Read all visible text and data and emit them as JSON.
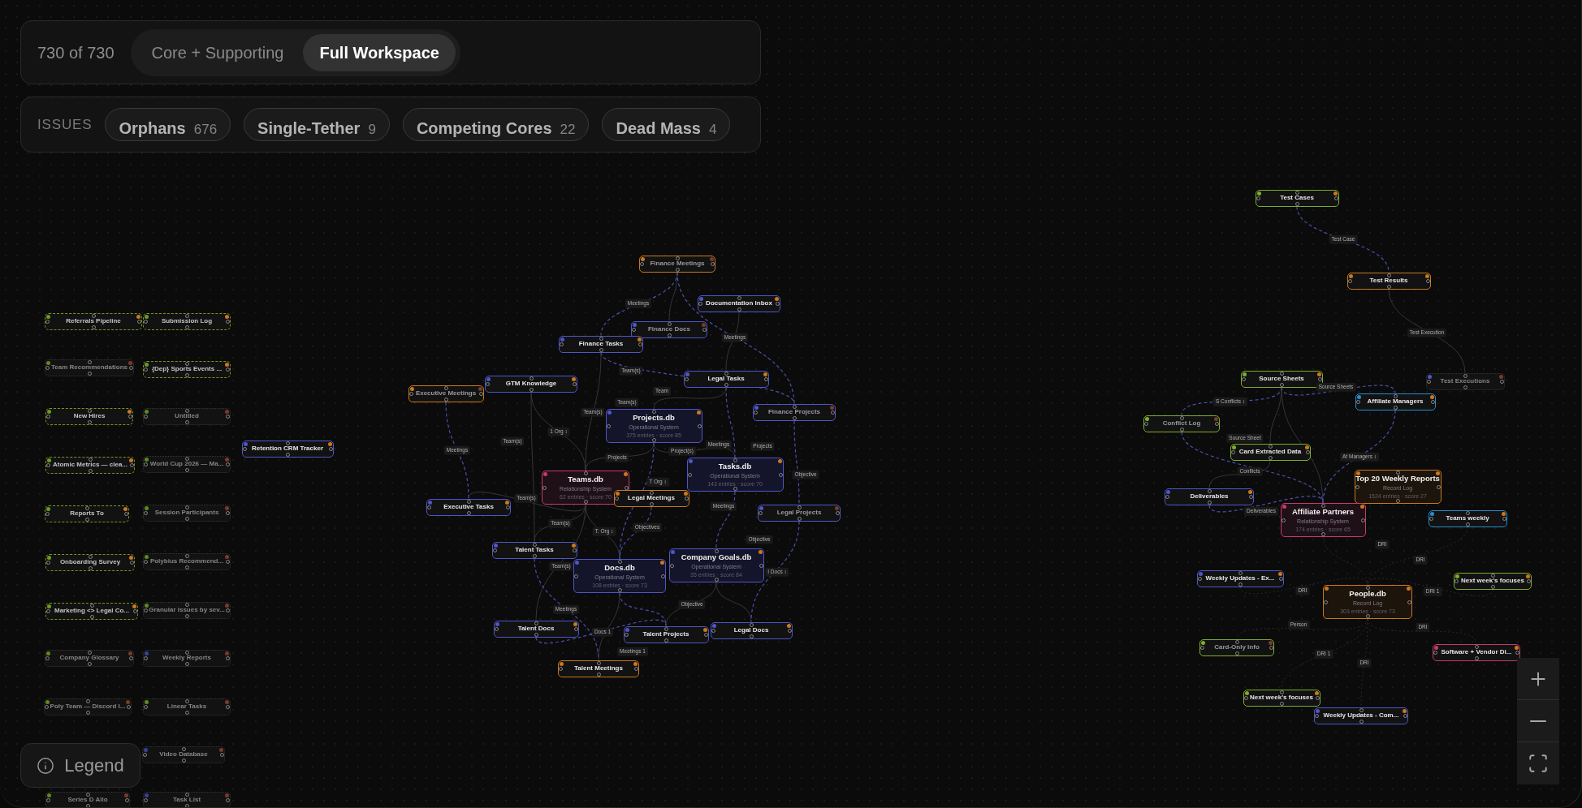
{
  "toolbar": {
    "count": "730 of 730",
    "views": [
      {
        "label": "Core + Supporting",
        "selected": false
      },
      {
        "label": "Full Workspace",
        "selected": true
      }
    ]
  },
  "issues": {
    "label": "ISSUES",
    "items": [
      {
        "name": "Orphans",
        "count": "676"
      },
      {
        "name": "Single-Tether",
        "count": "9"
      },
      {
        "name": "Competing Cores",
        "count": "22"
      },
      {
        "name": "Dead Mass",
        "count": "4"
      }
    ]
  },
  "nodes": [
    {
      "label": "Referrals Pipeline",
      "kind": "dashed",
      "color": "#6f9a22"
    },
    {
      "label": "Submission Log",
      "kind": "dashed",
      "color": "#6f9a22"
    },
    {
      "label": "Team Recommendations",
      "kind": "faint",
      "color": "#5f8a1e"
    },
    {
      "label": "{Dep} Sports Events ...",
      "kind": "dashed",
      "color": "#6f9a22"
    },
    {
      "label": "New Hires",
      "kind": "dashed",
      "color": "#6f9a22"
    },
    {
      "label": "Untitled",
      "kind": "faint",
      "color": "#5f8a1e"
    },
    {
      "label": "Atomic Metrics — clea...",
      "kind": "dashed",
      "color": "#6f9a22"
    },
    {
      "label": "World Cup 2026 — Ma...",
      "kind": "faint",
      "color": "#5f8a1e"
    },
    {
      "label": "Reports To",
      "kind": "dashed",
      "color": "#6f9a22"
    },
    {
      "label": "Session Participants",
      "kind": "faint",
      "color": "#5f8a1e"
    },
    {
      "label": "Onboarding Survey",
      "kind": "dashed",
      "color": "#6f9a22"
    },
    {
      "label": "Polybius Recommend...",
      "kind": "faint",
      "color": "#5f8a1e"
    },
    {
      "label": "Marketing <> Legal Co...",
      "kind": "dashed",
      "color": "#6f9a22"
    },
    {
      "label": "Granular issues by sev...",
      "kind": "faint",
      "color": "#5f8a1e"
    },
    {
      "label": "Company Glossary",
      "kind": "faint",
      "color": "#5f8a1e"
    },
    {
      "label": "Weekly Reports",
      "kind": "faint",
      "color": "#3b4096"
    },
    {
      "label": "Poly Team — Discord I...",
      "kind": "faint",
      "color": "#5f8a1e"
    },
    {
      "label": "Linear Tasks",
      "kind": "faint",
      "color": "#5f8a1e"
    },
    {
      "label": "Video Database",
      "kind": "faint",
      "color": "#3b4096"
    },
    {
      "label": "Series D Allo",
      "kind": "faint",
      "color": "#5f8a1e"
    },
    {
      "label": "Task List",
      "kind": "faint",
      "color": "#3b4096"
    },
    {
      "label": "Retention CRM Tracker",
      "kind": "solid",
      "color": "#4f56c8"
    },
    {
      "label": "Finance Meetings",
      "kind": "muted",
      "color": "#c9781f"
    },
    {
      "label": "Documentation Inbox",
      "kind": "solid",
      "color": "#4f56c8"
    },
    {
      "label": "Finance Docs",
      "kind": "muted",
      "color": "#4f56c8"
    },
    {
      "label": "Finance Tasks",
      "kind": "solid",
      "color": "#4f56c8"
    },
    {
      "label": "GTM Knowledge",
      "kind": "solid",
      "color": "#4f56c8"
    },
    {
      "label": "Executive Meetings",
      "kind": "muted",
      "color": "#c9781f"
    },
    {
      "label": "Legal Tasks",
      "kind": "solid",
      "color": "#4f56c8"
    },
    {
      "label": "Finance Projects",
      "kind": "muted",
      "color": "#4f56c8"
    },
    {
      "label": "Projects.db",
      "kind": "db",
      "color": "#4f56c8",
      "subtitle": "Operational System",
      "meta": "375 entries · score 85"
    },
    {
      "label": "Tasks.db",
      "kind": "db",
      "color": "#4f56c8",
      "subtitle": "Operational System",
      "meta": "143 entries · score 70"
    },
    {
      "label": "Teams.db",
      "kind": "db",
      "color": "#c73a6b",
      "subtitle": "Relationship System",
      "meta": "62 entries · score 70"
    },
    {
      "label": "Legal Meetings",
      "kind": "solid",
      "color": "#c9781f"
    },
    {
      "label": "Executive Tasks",
      "kind": "solid",
      "color": "#4f56c8"
    },
    {
      "label": "Legal Projects",
      "kind": "muted",
      "color": "#4f56c8"
    },
    {
      "label": "Talent Tasks",
      "kind": "solid",
      "color": "#4f56c8"
    },
    {
      "label": "Docs.db",
      "kind": "db",
      "color": "#4f56c8",
      "subtitle": "Operational System",
      "meta": "108 entries · score 73"
    },
    {
      "label": "Company Goals.db",
      "kind": "db",
      "color": "#4f56c8",
      "subtitle": "Operational System",
      "meta": "35 entries · score 84"
    },
    {
      "label": "Talent Docs",
      "kind": "solid",
      "color": "#4f56c8"
    },
    {
      "label": "Talent Projects",
      "kind": "solid",
      "color": "#4f56c8"
    },
    {
      "label": "Legal Docs",
      "kind": "solid",
      "color": "#4f56c8"
    },
    {
      "label": "Talent Meetings",
      "kind": "solid",
      "color": "#c9781f"
    },
    {
      "label": "Test Cases",
      "kind": "solid",
      "color": "#7cae2a"
    },
    {
      "label": "Test Results",
      "kind": "solid",
      "color": "#c9781f"
    },
    {
      "label": "Test Executions",
      "kind": "faint",
      "color": "#4f56c8"
    },
    {
      "label": "Source Sheets",
      "kind": "solid",
      "color": "#7cae2a"
    },
    {
      "label": "Affiliate Managers",
      "kind": "solid",
      "color": "#2a8ccc"
    },
    {
      "label": "Conflict Log",
      "kind": "muted",
      "color": "#7cae2a"
    },
    {
      "label": "Card Extracted Data",
      "kind": "solid",
      "color": "#7cae2a"
    },
    {
      "label": "Deliverables",
      "kind": "solid",
      "color": "#4f56c8"
    },
    {
      "label": "Top 20 Weekly Reports",
      "kind": "db",
      "color": "#c9781f",
      "subtitle": "Record Log",
      "meta": "1524 entries · score 27"
    },
    {
      "label": "Affiliate Partners",
      "kind": "db",
      "color": "#c73a6b",
      "subtitle": "Relationship System",
      "meta": "174 entries · score 65"
    },
    {
      "label": "Teams weekly",
      "kind": "solid",
      "color": "#2a8ccc"
    },
    {
      "label": "Weekly Updates - Ex...",
      "kind": "solid",
      "color": "#4f56c8"
    },
    {
      "label": "Next week's focuses",
      "kind": "solid",
      "color": "#7cae2a"
    },
    {
      "label": "People.db",
      "kind": "db",
      "color": "#c9781f",
      "subtitle": "Record Log",
      "meta": "303 entries · score 73"
    },
    {
      "label": "Card-Only Info",
      "kind": "muted",
      "color": "#7cae2a"
    },
    {
      "label": "Software + Vendor Di...",
      "kind": "solid",
      "color": "#c73a6b"
    },
    {
      "label": "Next week's focuses",
      "kind": "solid",
      "color": "#7cae2a"
    },
    {
      "label": "Weekly Updates - Com...",
      "kind": "solid",
      "color": "#4f56c8"
    }
  ],
  "edge_labels": [
    "Meetings",
    "Meetings",
    "Team(s)",
    "Team",
    "Team(s)",
    "Team(s)",
    "1 Org ↕",
    "Team(s)",
    "Meetings",
    "Project(s)",
    "Projects",
    "Meetings",
    "Projects",
    "T Org ↕",
    "Objective",
    "Team(s)",
    "Meetings",
    "Team(s)",
    "Objectives",
    "T: Org ↕",
    "Objective",
    "Team(s)",
    "I Docs ↕",
    "Objective",
    "Meetings",
    "Docs 1",
    "Meetings 1",
    "Test Case",
    "Test Execution",
    "Source Sheets",
    "S Conflicts ↕",
    "Source Sheet",
    "Af Managers ↕",
    "Conflicts",
    "Deliverables",
    "DRI",
    "DRI",
    "DRI",
    "DRI 1",
    "Person",
    "DRI",
    "DRI 1",
    "DRI"
  ],
  "legend": {
    "label": "Legend"
  }
}
